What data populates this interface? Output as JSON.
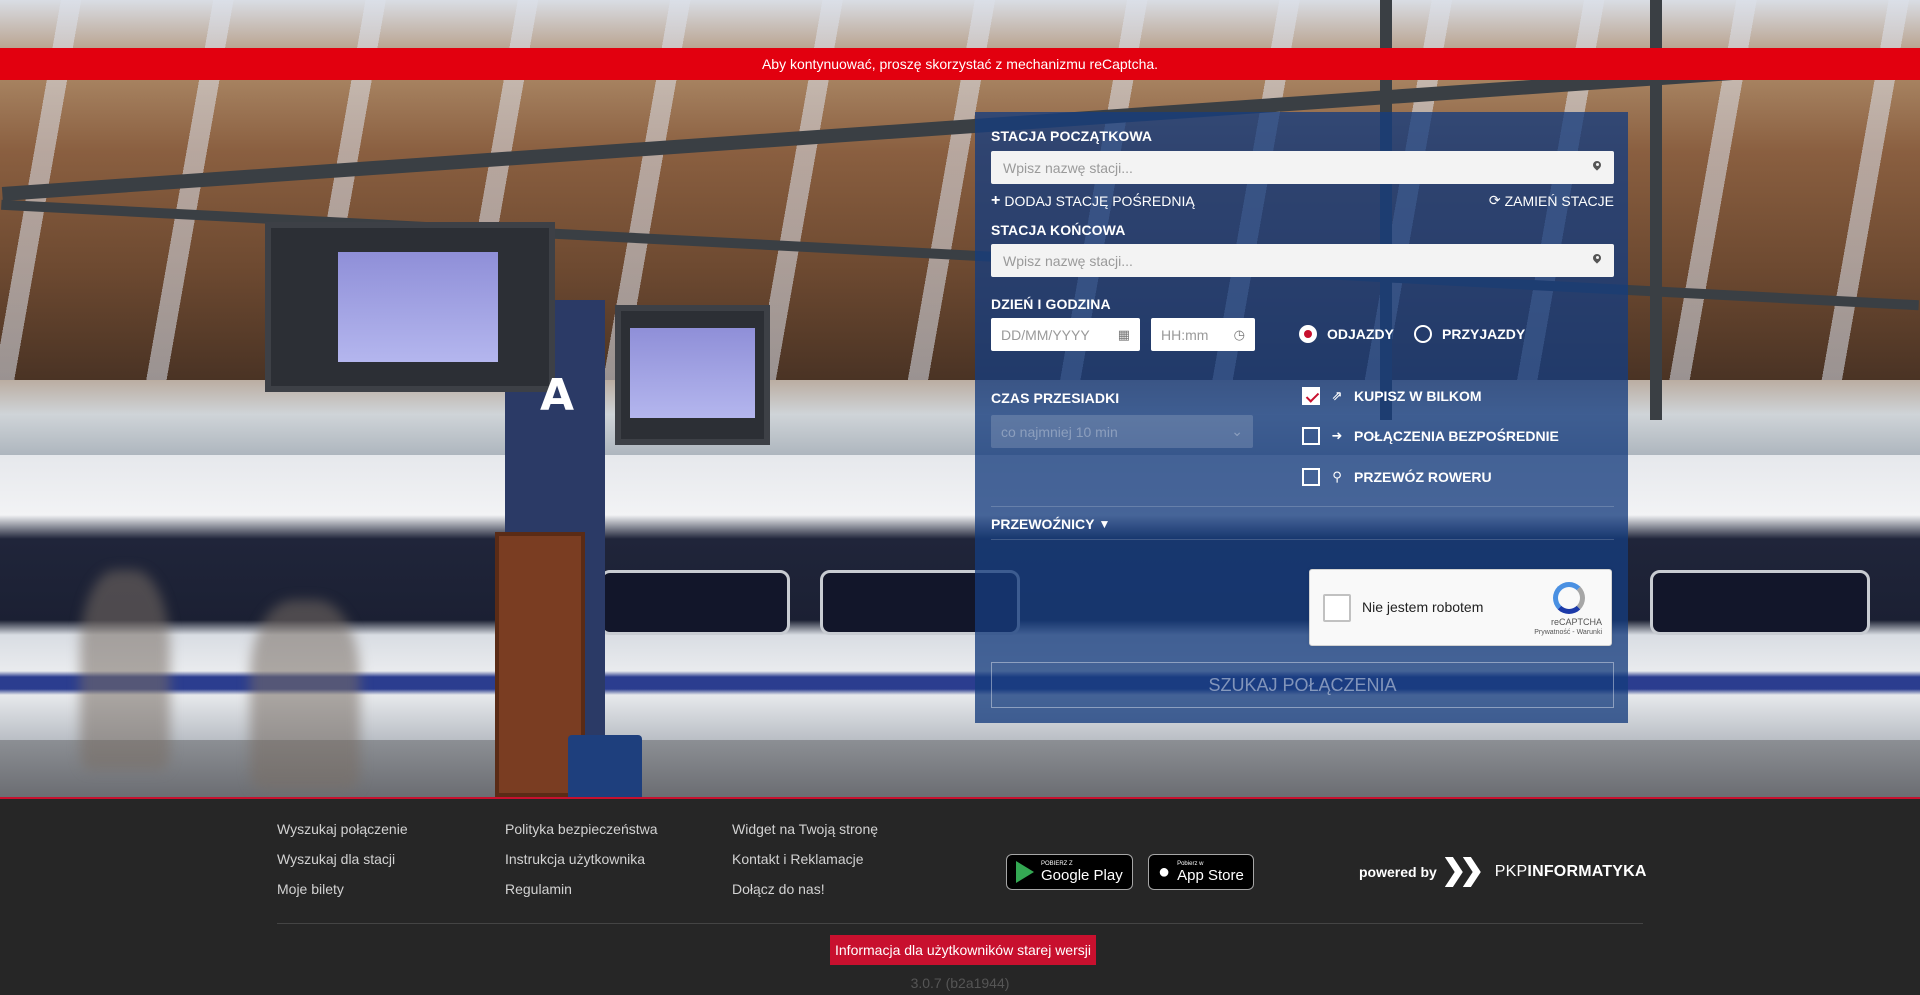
{
  "alert": {
    "message": "Aby kontynuować, proszę skorzystać z mechanizmu reCaptcha."
  },
  "search": {
    "start_label": "Stacja początkowa",
    "start_placeholder": "Wpisz nazwę stacji...",
    "add_intermediate": "Dodaj stację pośrednią",
    "swap_stations": "Zamień stacje",
    "end_label": "Stacja końcowa",
    "end_placeholder": "Wpisz nazwę stacji...",
    "datetime_label": "Dzień i godzina",
    "date_placeholder": "DD/MM/YYYY",
    "time_placeholder": "HH:mm",
    "departures": "Odjazdy",
    "arrivals": "Przyjazdy",
    "departures_selected": true,
    "transfer_label": "Czas przesiadki",
    "transfer_value": "co najmniej 10 min",
    "options": {
      "bilkom": "Kupisz w Bilkom",
      "direct": "Połączenia bezpośrednie",
      "bike": "Przewóz roweru"
    },
    "bilkom_checked": true,
    "carriers_label": "Przewoźnicy",
    "captcha": {
      "label": "Nie jestem robotem",
      "brand": "reCAPTCHA",
      "terms": "Prywatność - Warunki"
    },
    "submit_label": "Szukaj połączenia"
  },
  "footer": {
    "col1": [
      "Wyszukaj połączenie",
      "Wyszukaj dla stacji",
      "Moje bilety"
    ],
    "col2": [
      "Polityka bezpieczeństwa",
      "Instrukcja użytkownika",
      "Regulamin"
    ],
    "col3": [
      "Widget na Twoją stronę",
      "Kontakt i Reklamacje",
      "Dołącz do nas!"
    ],
    "google_play": {
      "small": "POBIERZ Z",
      "big": "Google Play"
    },
    "app_store": {
      "small": "Pobierz w",
      "big": "App Store"
    },
    "powered_by": "powered by",
    "pkp_light": "PKP",
    "pkp_bold": "INFORMATYKA",
    "legacy_info": "Informacja dla użytkowników starej wersji",
    "version": "3.0.7 (b2a1944)"
  },
  "colors": {
    "alert_red": "#e2000f",
    "panel_blue": "#163c7d",
    "accent_red": "#c8102e"
  }
}
